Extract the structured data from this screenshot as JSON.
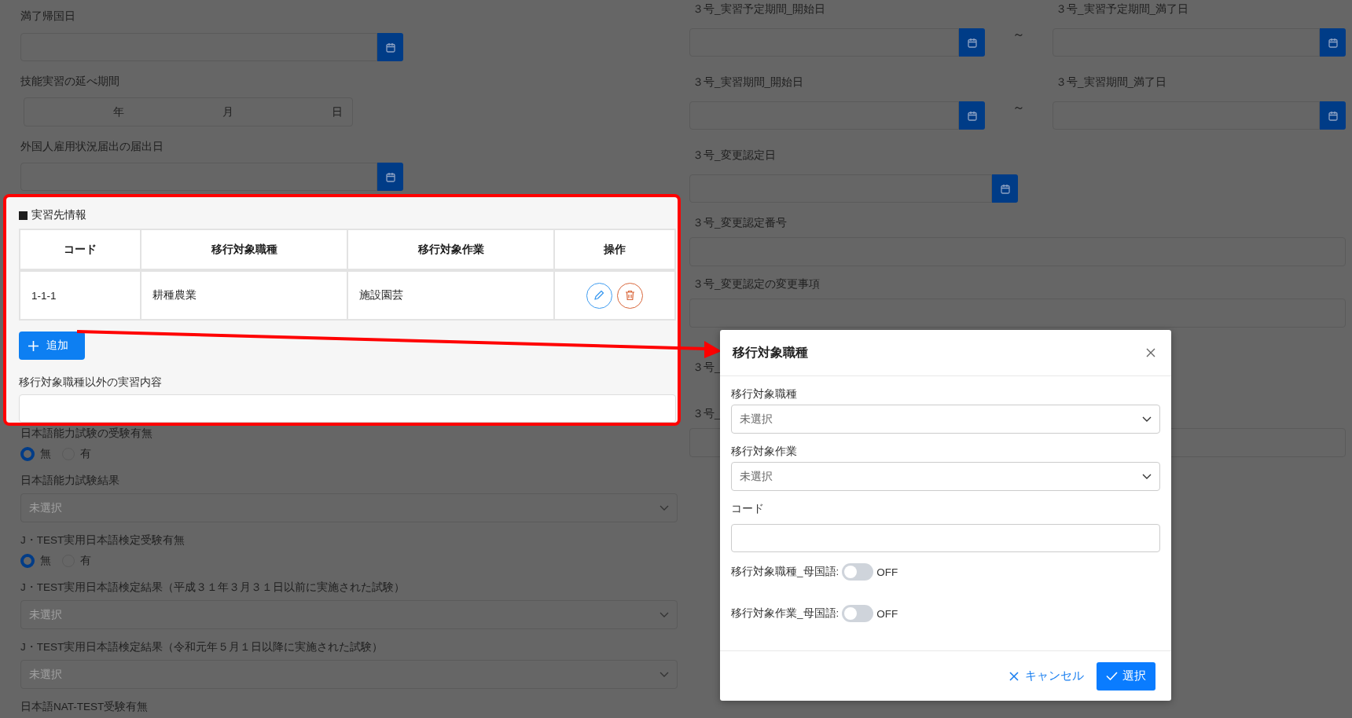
{
  "form_left": [
    {
      "kind": "date",
      "label": "満了帰国日"
    },
    {
      "kind": "duration",
      "label": "技能実習の延べ期間",
      "units": [
        "年",
        "月",
        "日"
      ]
    },
    {
      "kind": "date",
      "label": "外国人雇用状況届出の届出日"
    }
  ],
  "section": {
    "title": "実習先情報",
    "columns": [
      "コード",
      "移行対象職種",
      "移行対象作業",
      "操作"
    ],
    "rows": [
      {
        "cells": [
          "1-1-1",
          "耕種農業",
          "施設園芸"
        ]
      }
    ],
    "add_button": "追加",
    "field_label": "移行対象職種以外の実習内容"
  },
  "form_left_lower": [
    {
      "kind": "radio",
      "label": "日本語能力試験の受験有無",
      "options": [
        {
          "label": "無",
          "selected": true
        },
        {
          "label": "有",
          "selected": false
        }
      ]
    },
    {
      "kind": "select",
      "label": "日本語能力試験結果",
      "placeholder": "未選択"
    },
    {
      "kind": "radio",
      "label": "J・TEST実用日本語検定受験有無",
      "options": [
        {
          "label": "無",
          "selected": true
        },
        {
          "label": "有",
          "selected": false
        }
      ]
    },
    {
      "kind": "select",
      "label": "J・TEST実用日本語検定結果（平成３１年３月３１日以前に実施された試験）",
      "placeholder": "未選択"
    },
    {
      "kind": "select",
      "label": "J・TEST実用日本語検定結果（令和元年５月１日以降に実施された試験）",
      "placeholder": "未選択"
    },
    {
      "kind": "label",
      "label": "日本語NAT-TEST受験有無"
    }
  ],
  "form_right": [
    {
      "kind": "date_range",
      "labels": [
        "３号_実習予定期間_開始日",
        "３号_実習予定期間_満了日"
      ],
      "separator": "～"
    },
    {
      "kind": "date_range",
      "labels": [
        "３号_実習期間_開始日",
        "３号_実習期間_満了日"
      ],
      "separator": "～"
    },
    {
      "kind": "date",
      "label": "３号_変更認定日"
    },
    {
      "kind": "text",
      "label": "３号_変更認定番号"
    },
    {
      "kind": "text",
      "label": "３号_変更認定の変更事項"
    },
    {
      "kind": "label",
      "label": "３号_"
    },
    {
      "kind": "text",
      "label": "３号_"
    }
  ],
  "dialog": {
    "title": "移行対象職種",
    "fields": [
      {
        "kind": "select",
        "label": "移行対象職種",
        "placeholder": "未選択"
      },
      {
        "kind": "select",
        "label": "移行対象作業",
        "placeholder": "未選択"
      },
      {
        "kind": "text",
        "label": "コード"
      }
    ],
    "toggles": [
      {
        "label": "移行対象職種_母国語:",
        "on": false,
        "state": "OFF"
      },
      {
        "label": "移行対象作業_母国語:",
        "on": false,
        "state": "OFF"
      }
    ],
    "cancel": "キャンセル",
    "confirm": "選択"
  }
}
